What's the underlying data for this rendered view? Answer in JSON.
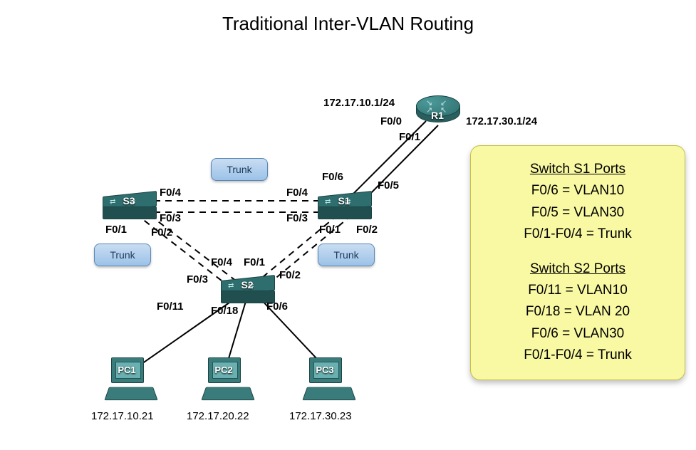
{
  "title": "Traditional Inter-VLAN Routing",
  "devices": {
    "router": {
      "name": "R1",
      "ip_left": "172.17.10.1/24",
      "ip_right": "172.17.30.1/24",
      "ports": {
        "left": "F0/0",
        "right": "F0/1"
      }
    },
    "s1": {
      "name": "S1",
      "ports": {
        "up_left": "F0/6",
        "up_right": "F0/5",
        "left_top": "F0/4",
        "left_bot": "F0/3",
        "down_left": "F0/1",
        "down_right": "F0/2"
      }
    },
    "s2": {
      "name": "S2",
      "ports": {
        "up_left": "F0/4",
        "up_mid": "F0/1",
        "up_right": "F0/2",
        "up_farleft": "F0/3",
        "down_left": "F0/11",
        "down_mid": "F0/18",
        "down_right": "F0/6"
      }
    },
    "s3": {
      "name": "S3",
      "ports": {
        "right_top": "F0/4",
        "right_bot": "F0/3",
        "down_left": "F0/1",
        "down_right": "F0/2"
      }
    },
    "pc1": {
      "name": "PC1",
      "ip": "172.17.10.21"
    },
    "pc2": {
      "name": "PC2",
      "ip": "172.17.20.22"
    },
    "pc3": {
      "name": "PC3",
      "ip": "172.17.30.23"
    }
  },
  "trunk_label": "Trunk",
  "legend": {
    "s1_title": "Switch S1 Ports",
    "s1_lines": [
      "F0/6 = VLAN10",
      "F0/5 = VLAN30",
      "F0/1-F0/4 = Trunk"
    ],
    "s2_title": "Switch S2 Ports",
    "s2_lines": [
      "F0/11 = VLAN10",
      "F0/18 = VLAN 20",
      "F0/6 = VLAN30",
      "F0/1-F0/4 = Trunk"
    ]
  }
}
